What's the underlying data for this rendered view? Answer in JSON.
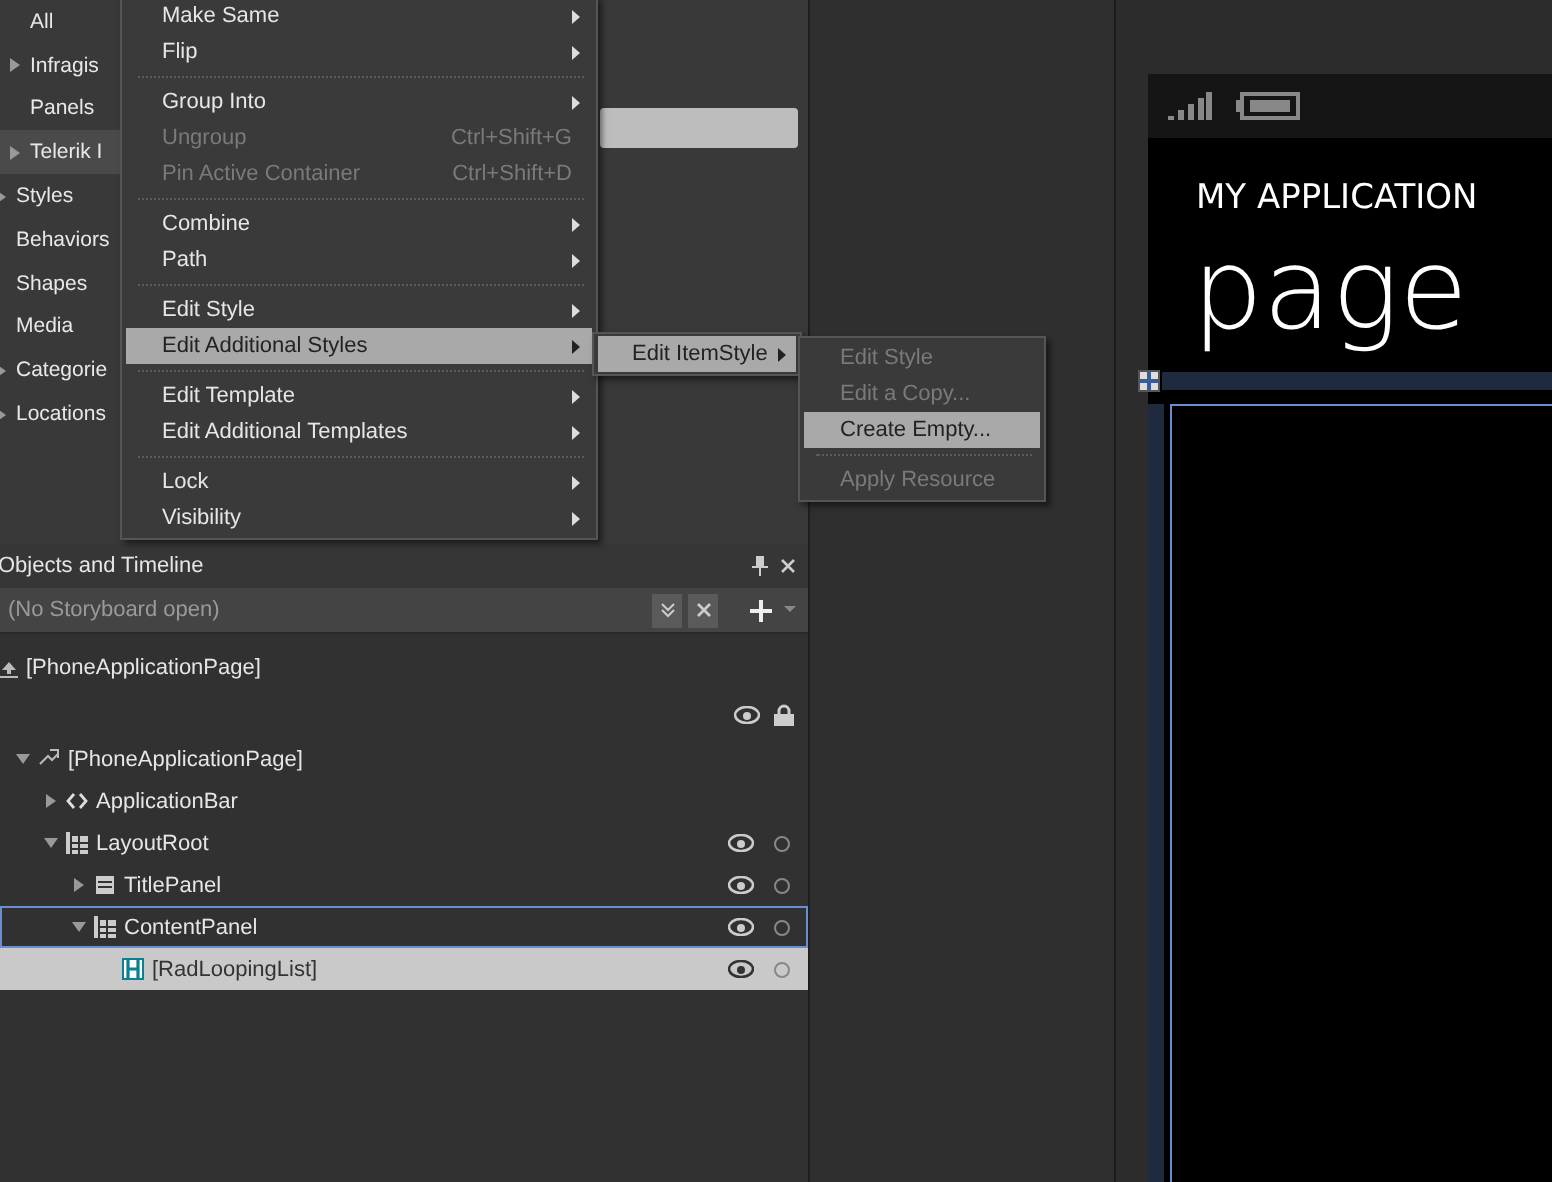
{
  "asset_list": {
    "subitems": [
      {
        "label": "All",
        "expandable": false,
        "selected": false
      },
      {
        "label": "Infragis",
        "expandable": true,
        "selected": false
      },
      {
        "label": "Panels",
        "expandable": false,
        "selected": false
      },
      {
        "label": "Telerik I",
        "expandable": true,
        "selected": true
      }
    ],
    "categories": [
      {
        "label": "Styles",
        "expandable": true
      },
      {
        "label": "Behaviors",
        "expandable": false
      },
      {
        "label": "Shapes",
        "expandable": false
      },
      {
        "label": "Media",
        "expandable": false
      },
      {
        "label": "Categorie",
        "expandable": true
      },
      {
        "label": "Locations",
        "expandable": true
      }
    ]
  },
  "context_menu": [
    {
      "kind": "item",
      "label": "Make Same",
      "submenu": true,
      "disabled": false,
      "selected": false
    },
    {
      "kind": "item",
      "label": "Flip",
      "submenu": true,
      "disabled": false,
      "selected": false
    },
    {
      "kind": "separator"
    },
    {
      "kind": "item",
      "label": "Group Into",
      "submenu": true,
      "disabled": false,
      "selected": false
    },
    {
      "kind": "item",
      "label": "Ungroup",
      "shortcut": "Ctrl+Shift+G",
      "submenu": false,
      "disabled": true,
      "selected": false
    },
    {
      "kind": "item",
      "label": "Pin Active Container",
      "shortcut": "Ctrl+Shift+D",
      "submenu": false,
      "disabled": true,
      "selected": false
    },
    {
      "kind": "separator"
    },
    {
      "kind": "item",
      "label": "Combine",
      "submenu": true,
      "disabled": false,
      "selected": false
    },
    {
      "kind": "item",
      "label": "Path",
      "submenu": true,
      "disabled": false,
      "selected": false
    },
    {
      "kind": "separator"
    },
    {
      "kind": "item",
      "label": "Edit Style",
      "submenu": true,
      "disabled": false,
      "selected": false
    },
    {
      "kind": "item",
      "label": "Edit Additional Styles",
      "submenu": true,
      "disabled": false,
      "selected": true
    },
    {
      "kind": "separator"
    },
    {
      "kind": "item",
      "label": "Edit Template",
      "submenu": true,
      "disabled": false,
      "selected": false
    },
    {
      "kind": "item",
      "label": "Edit Additional Templates",
      "submenu": true,
      "disabled": false,
      "selected": false
    },
    {
      "kind": "separator"
    },
    {
      "kind": "item",
      "label": "Lock",
      "submenu": true,
      "disabled": false,
      "selected": false
    },
    {
      "kind": "item",
      "label": "Visibility",
      "submenu": true,
      "disabled": false,
      "selected": false
    }
  ],
  "submenu": [
    {
      "kind": "item",
      "label": "Edit ItemStyle",
      "submenu": true,
      "selected": true
    }
  ],
  "submenu_2": [
    {
      "kind": "item",
      "label": "Edit Style",
      "submenu": false,
      "disabled": true,
      "selected": false
    },
    {
      "kind": "item",
      "label": "Edit a Copy...",
      "submenu": false,
      "disabled": true,
      "selected": false
    },
    {
      "kind": "item",
      "label": "Create Empty...",
      "submenu": false,
      "disabled": false,
      "selected": true
    },
    {
      "kind": "separator"
    },
    {
      "kind": "item",
      "label": "Apply Resource",
      "submenu": false,
      "disabled": true,
      "selected": false
    }
  ],
  "objects_panel": {
    "title": "Objects and Timeline",
    "storyboard": "(No Storyboard open)",
    "scope": "[PhoneApplicationPage]",
    "tree": [
      {
        "label": "[PhoneApplicationPage]",
        "expanded": true,
        "selected": false,
        "focused": false,
        "visibility": false,
        "children": [
          {
            "label": "ApplicationBar",
            "expanded": false,
            "selected": false,
            "focused": false,
            "visibility": false
          },
          {
            "label": "LayoutRoot",
            "expanded": true,
            "selected": false,
            "focused": false,
            "visibility": true,
            "children": [
              {
                "label": "TitlePanel",
                "expanded": false,
                "selected": false,
                "focused": false,
                "visibility": true
              },
              {
                "label": "ContentPanel",
                "expanded": true,
                "selected": false,
                "focused": true,
                "visibility": true,
                "children": [
                  {
                    "label": "[RadLoopingList]",
                    "selected": true,
                    "focused": false,
                    "visibility": true
                  }
                ]
              }
            ]
          }
        ]
      }
    ]
  },
  "phone": {
    "app_title": "MY APPLICATION",
    "page_title": "page"
  }
}
